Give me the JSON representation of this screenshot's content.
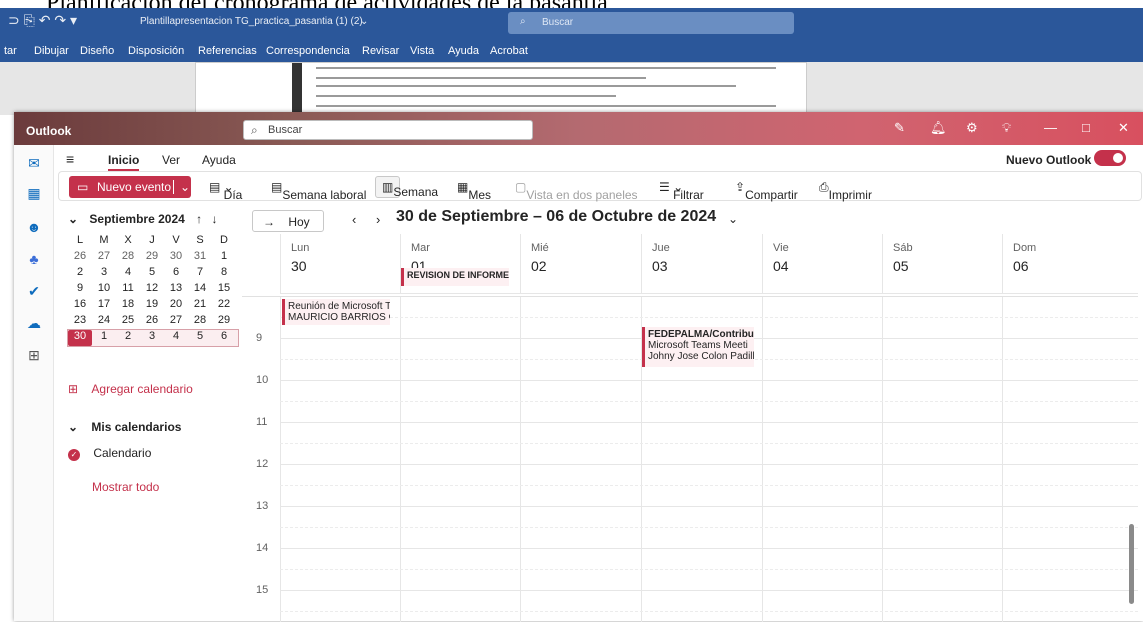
{
  "background_doc": {
    "heading_fragment": "Planificación del cronograma de actividades de la pasantía",
    "file_title": "Plantillapresentacion TG_practica_pasantia (1) (2)",
    "search": "Buscar",
    "menu": [
      "tar",
      "Dibujar",
      "Diseño",
      "Disposición",
      "Referencias",
      "Correspondencia",
      "Revisar",
      "Vista",
      "Ayuda",
      "Acrobat"
    ]
  },
  "app": {
    "name": "Outlook",
    "search_placeholder": "Buscar",
    "new_outlook_label": "Nuevo Outlook"
  },
  "ribbon_tabs": [
    "Inicio",
    "Ver",
    "Ayuda"
  ],
  "ribbon": {
    "new_event": "Nuevo evento",
    "day": "Día",
    "work_week": "Semana laboral",
    "week": "Semana",
    "month": "Mes",
    "split_view": "Vista en dos paneles",
    "filter": "Filtrar",
    "share": "Compartir",
    "print": "Imprimir"
  },
  "mini_calendar": {
    "month_label": "Septiembre 2024",
    "weekdays": [
      "L",
      "M",
      "X",
      "J",
      "V",
      "S",
      "D"
    ],
    "weeks": [
      [
        "26",
        "27",
        "28",
        "29",
        "30",
        "31",
        "1"
      ],
      [
        "2",
        "3",
        "4",
        "5",
        "6",
        "7",
        "8"
      ],
      [
        "9",
        "10",
        "11",
        "12",
        "13",
        "14",
        "15"
      ],
      [
        "16",
        "17",
        "18",
        "19",
        "20",
        "21",
        "22"
      ],
      [
        "23",
        "24",
        "25",
        "26",
        "27",
        "28",
        "29"
      ],
      [
        "30",
        "1",
        "2",
        "3",
        "4",
        "5",
        "6"
      ]
    ],
    "today": "30"
  },
  "nav": {
    "add_calendar": "Agregar calendario",
    "my_calendars": "Mis calendarios",
    "calendar": "Calendario",
    "show_all": "Mostrar todo"
  },
  "week_view": {
    "today_button": "Hoy",
    "range": "30 de Septiembre – 06 de Octubre de 2024",
    "days": [
      {
        "name": "Lun",
        "date": "30"
      },
      {
        "name": "Mar",
        "date": "01"
      },
      {
        "name": "Mié",
        "date": "02"
      },
      {
        "name": "Jue",
        "date": "03"
      },
      {
        "name": "Vie",
        "date": "04"
      },
      {
        "name": "Sáb",
        "date": "05"
      },
      {
        "name": "Dom",
        "date": "06"
      }
    ],
    "hours": [
      "9",
      "10",
      "11",
      "12",
      "13",
      "14",
      "15"
    ]
  },
  "events": [
    {
      "day": "Mar",
      "allday": true,
      "title": "REVISION DE INFORME"
    },
    {
      "day": "Lun",
      "title": "Reunión de Microsoft T",
      "subtitle": "MAURICIO BARRIOS ⟳"
    },
    {
      "day": "Jue",
      "title": "FEDEPALMA/Contribu",
      "subtitle": "Microsoft Teams Meeti",
      "subtitle2": "Johny Jose Colon Padill"
    }
  ],
  "colors": {
    "accent": "#c4314b",
    "word_blue": "#2b579a"
  }
}
